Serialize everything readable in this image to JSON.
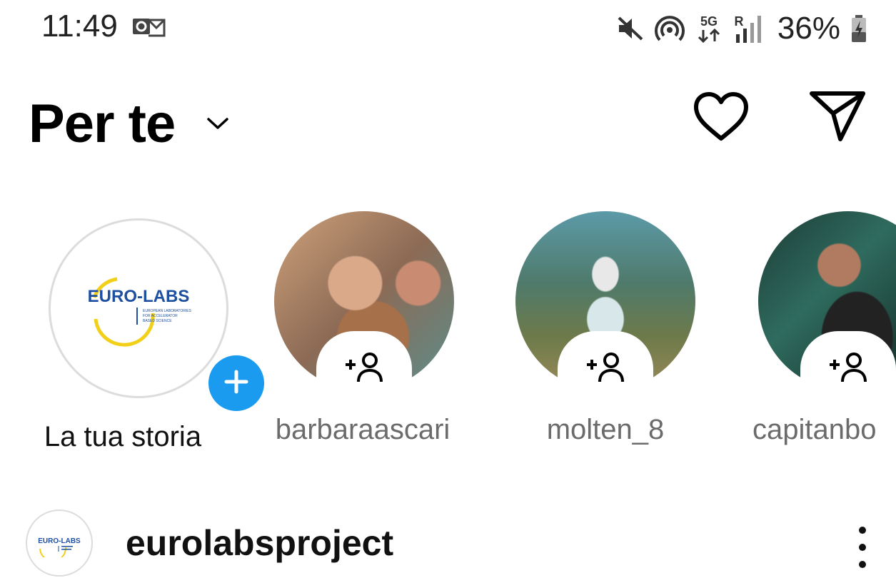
{
  "status_bar": {
    "time": "11:49",
    "battery": "36%",
    "network_label": "5G",
    "roaming_label": "R",
    "icons": [
      "outlook-icon",
      "mute-icon",
      "hotspot-icon",
      "5g-icon",
      "signal-icon",
      "battery-charging-icon"
    ]
  },
  "header": {
    "title": "Per te",
    "icons": [
      "chevron-down-icon",
      "heart-icon",
      "send-icon"
    ]
  },
  "stories": [
    {
      "label": "La tua storia",
      "type": "own",
      "logo_text": "EURO-LABS",
      "logo_sub": [
        "EUROPEAN LABORATORIES",
        "FOR ACCELERATOR",
        "BASED SCIENCE"
      ]
    },
    {
      "label": "barbaraascari",
      "type": "suggested"
    },
    {
      "label": "molten_8",
      "type": "suggested"
    },
    {
      "label": "capitanbo",
      "type": "suggested"
    }
  ],
  "post": {
    "username": "eurolabsproject",
    "avatar_logo_text": "EURO-LABS"
  },
  "colors": {
    "accent": "#1a9bf0",
    "text": "#000000",
    "secondary_text": "#6b6b6b",
    "logo_blue": "#1e4fa0",
    "logo_yellow": "#f2d01a"
  }
}
